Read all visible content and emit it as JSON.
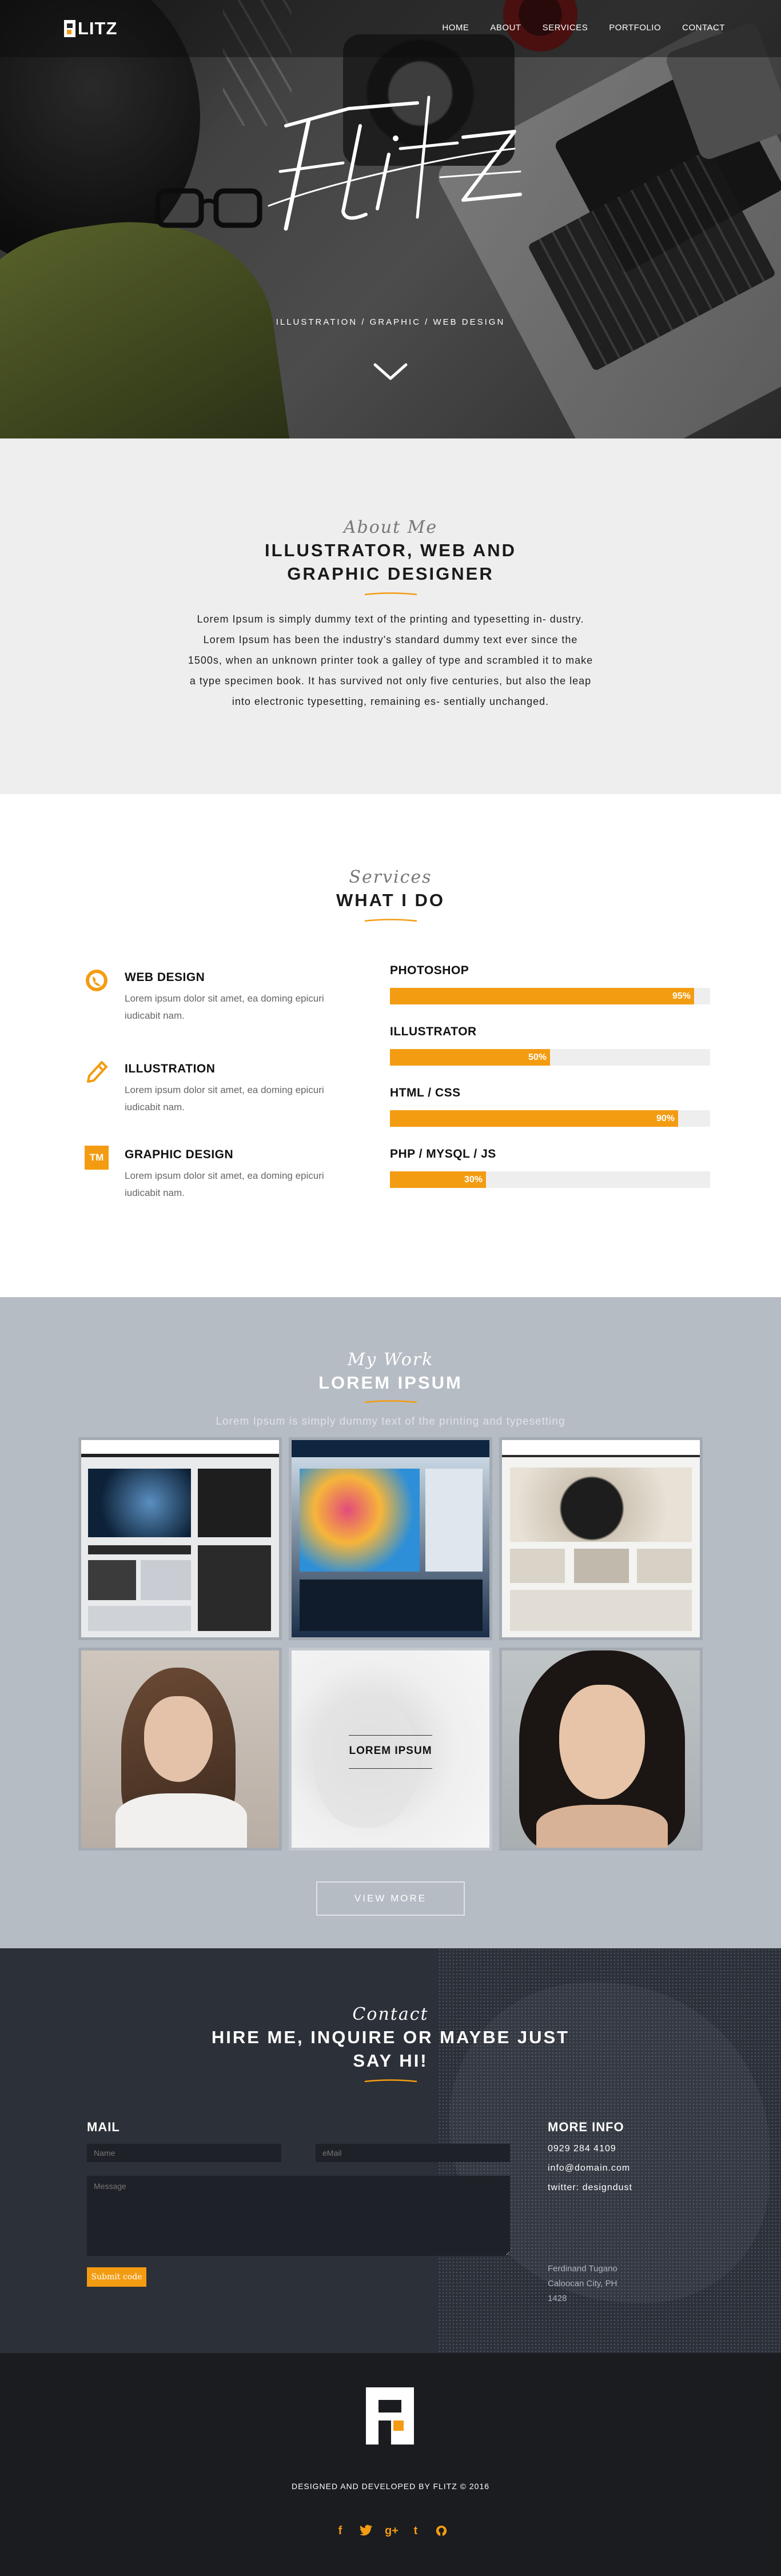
{
  "brand": {
    "logo_text": "LITZ"
  },
  "nav": {
    "items": [
      "HOME",
      "ABOUT",
      "SERVICES",
      "PORTFOLIO",
      "CONTACT"
    ]
  },
  "hero": {
    "tagline": "ILLUSTRATION / GRAPHIC / WEB DESIGN"
  },
  "about": {
    "script": "About Me",
    "title_line1": "ILLUSTRATOR, WEB AND",
    "title_line2": "GRAPHIC DESIGNER",
    "body": "Lorem Ipsum is simply dummy text of the printing and typesetting in- dustry. Lorem Ipsum has been the industry's standard dummy text ever since the 1500s, when an unknown printer took a galley of type and scrambled it to make a type specimen book. It has survived not only five centuries, but also the leap into electronic typesetting, remaining es- sentially unchanged."
  },
  "services": {
    "script": "Services",
    "title": "WHAT I DO",
    "items": [
      {
        "title": "WEB DESIGN",
        "desc": "Lorem ipsum dolor sit amet, ea doming epicuri iudicabit nam.",
        "icon": "globe-icon"
      },
      {
        "title": "ILLUSTRATION",
        "desc": "Lorem ipsum dolor sit amet, ea doming epicuri iudicabit nam.",
        "icon": "pen-icon"
      },
      {
        "title": "GRAPHIC DESIGN",
        "desc": "Lorem ipsum dolor sit amet, ea doming epicuri iudicabit nam.",
        "icon": "tm-icon",
        "icon_text": "TM"
      }
    ],
    "skills": [
      {
        "name": "PHOTOSHOP",
        "percent": 95,
        "label": "95%"
      },
      {
        "name": "ILLUSTRATOR",
        "percent": 50,
        "label": "50%"
      },
      {
        "name": "HTML / CSS",
        "percent": 90,
        "label": "90%"
      },
      {
        "name": "PHP / MYSQL / JS",
        "percent": 30,
        "label": "30%"
      }
    ]
  },
  "portfolio": {
    "script": "My Work",
    "title": "LOREM IPSUM",
    "subtitle": "Lorem Ipsum is simply dummy text of the printing and typesetting",
    "hover_label": "LOREM IPSUM",
    "view_more": "VIEW MORE"
  },
  "contact": {
    "script": "Contact",
    "title_line1": "HIRE ME, INQUIRE OR MAYBE JUST",
    "title_line2": "SAY HI!",
    "mail_title": "MAIL",
    "name_placeholder": "Name",
    "email_placeholder": "eMail",
    "message_placeholder": "Message",
    "submit": "Submit code",
    "more_title": "MORE INFO",
    "phone": "0929 284 4109",
    "email": "info@domain.com",
    "twitter": "twitter: designdust",
    "address_line1": "Ferdinand Tugano",
    "address_line2": "Caloocan City, PH",
    "address_line3": "1428"
  },
  "footer": {
    "copyright": "DESIGNED AND DEVELOPED BY FLITZ © 2016",
    "social": [
      "facebook-icon",
      "twitter-icon",
      "google-plus-icon",
      "tumblr-icon",
      "github-icon"
    ]
  },
  "colors": {
    "accent": "#f39c12",
    "portfolio_bg": "#b6bcc4",
    "contact_bg": "#2c3038",
    "footer_bg": "#1a1c20"
  }
}
